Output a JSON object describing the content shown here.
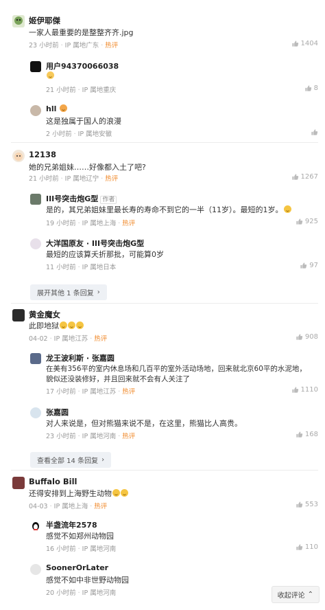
{
  "comments": [
    {
      "user": "姬伊耶傑",
      "text": "一家人最重要的是整整齐齐.jpg",
      "time": "23 小时前",
      "location": "IP 属地广东",
      "hot": "热评",
      "likes": "1404",
      "replies": [
        {
          "user": "用户94370066038",
          "text": "",
          "time": "21 小时前",
          "location": "IP 属地重庆",
          "likes": "8"
        },
        {
          "user": "hll",
          "text": "这是独属于国人的浪漫",
          "time": "2 小时前",
          "location": "IP 属地安徽",
          "likes": ""
        }
      ]
    },
    {
      "user": "12138",
      "text": "她的兄弟姐妹……好像都入土了吧?",
      "time": "21 小时前",
      "location": "IP 属地辽宁",
      "hot": "热评",
      "likes": "1267",
      "replies": [
        {
          "user": "III号突击炮G型",
          "tag": "作者",
          "text": "是的，其兄弟姐妹里最长寿的寿命不到它的一半（11岁）。最短的1岁。",
          "time": "19 小时前",
          "location": "IP 属地上海",
          "hot": "热评",
          "likes": "925"
        },
        {
          "user": "大洋国原友 · III号突击炮G型",
          "text": "最短的应该算夭折那批，可能算0岁",
          "time": "11 小时前",
          "location": "IP 属地日本",
          "likes": "97"
        }
      ],
      "expand": "展开其他 1 条回复"
    },
    {
      "user": "黄金魔女",
      "text": "此即地狱",
      "time": "04-02",
      "location": "IP 属地江苏",
      "hot": "热评",
      "likes": "908",
      "replies": [
        {
          "user": "龙王波利斯 · 张嘉圆",
          "text": "在美有356平的室内休息场和几百平的室外活动场地，回来就北京60平的水泥地，",
          "text2": "貌似还没装修好，并且回来就不会有人关注了",
          "time": "17 小时前",
          "location": "IP 属地江苏",
          "hot": "热评",
          "likes": "1110"
        },
        {
          "user": "张嘉圆",
          "text": "对人来说是，但对熊猫来说不是，在这里，熊猫比人高贵。",
          "time": "23 小时前",
          "location": "IP 属地河南",
          "hot": "热评",
          "likes": "168"
        }
      ],
      "expand": "查看全部 14 条回复"
    },
    {
      "user": "Buffalo Bill",
      "text": "还得安排到上海野生动物",
      "time": "04-03",
      "location": "IP 属地上海",
      "hot": "热评",
      "likes": "553",
      "replies": [
        {
          "user": "半盏流年2578",
          "text": "感觉不如郑州动物园",
          "time": "16 小时前",
          "location": "IP 属地河南",
          "likes": "110"
        },
        {
          "user": "SoonerOrLater",
          "text": "感觉不如中非世野动物园",
          "time": "20 小时前",
          "location": "IP 属地河南",
          "likes": ""
        }
      ]
    }
  ],
  "fold_button": "收起评论",
  "colors": {
    "hot": "#f08a2c",
    "meta": "#999999",
    "expand_bg": "#eef1f5"
  }
}
